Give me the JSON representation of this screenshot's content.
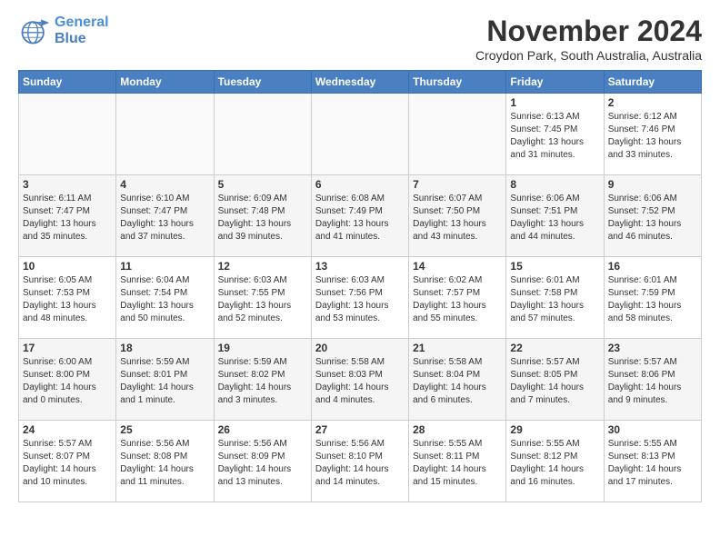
{
  "header": {
    "logo_line1": "General",
    "logo_line2": "Blue",
    "month": "November 2024",
    "location": "Croydon Park, South Australia, Australia"
  },
  "days_of_week": [
    "Sunday",
    "Monday",
    "Tuesday",
    "Wednesday",
    "Thursday",
    "Friday",
    "Saturday"
  ],
  "weeks": [
    [
      {
        "day": "",
        "info": ""
      },
      {
        "day": "",
        "info": ""
      },
      {
        "day": "",
        "info": ""
      },
      {
        "day": "",
        "info": ""
      },
      {
        "day": "",
        "info": ""
      },
      {
        "day": "1",
        "info": "Sunrise: 6:13 AM\nSunset: 7:45 PM\nDaylight: 13 hours\nand 31 minutes."
      },
      {
        "day": "2",
        "info": "Sunrise: 6:12 AM\nSunset: 7:46 PM\nDaylight: 13 hours\nand 33 minutes."
      }
    ],
    [
      {
        "day": "3",
        "info": "Sunrise: 6:11 AM\nSunset: 7:47 PM\nDaylight: 13 hours\nand 35 minutes."
      },
      {
        "day": "4",
        "info": "Sunrise: 6:10 AM\nSunset: 7:47 PM\nDaylight: 13 hours\nand 37 minutes."
      },
      {
        "day": "5",
        "info": "Sunrise: 6:09 AM\nSunset: 7:48 PM\nDaylight: 13 hours\nand 39 minutes."
      },
      {
        "day": "6",
        "info": "Sunrise: 6:08 AM\nSunset: 7:49 PM\nDaylight: 13 hours\nand 41 minutes."
      },
      {
        "day": "7",
        "info": "Sunrise: 6:07 AM\nSunset: 7:50 PM\nDaylight: 13 hours\nand 43 minutes."
      },
      {
        "day": "8",
        "info": "Sunrise: 6:06 AM\nSunset: 7:51 PM\nDaylight: 13 hours\nand 44 minutes."
      },
      {
        "day": "9",
        "info": "Sunrise: 6:06 AM\nSunset: 7:52 PM\nDaylight: 13 hours\nand 46 minutes."
      }
    ],
    [
      {
        "day": "10",
        "info": "Sunrise: 6:05 AM\nSunset: 7:53 PM\nDaylight: 13 hours\nand 48 minutes."
      },
      {
        "day": "11",
        "info": "Sunrise: 6:04 AM\nSunset: 7:54 PM\nDaylight: 13 hours\nand 50 minutes."
      },
      {
        "day": "12",
        "info": "Sunrise: 6:03 AM\nSunset: 7:55 PM\nDaylight: 13 hours\nand 52 minutes."
      },
      {
        "day": "13",
        "info": "Sunrise: 6:03 AM\nSunset: 7:56 PM\nDaylight: 13 hours\nand 53 minutes."
      },
      {
        "day": "14",
        "info": "Sunrise: 6:02 AM\nSunset: 7:57 PM\nDaylight: 13 hours\nand 55 minutes."
      },
      {
        "day": "15",
        "info": "Sunrise: 6:01 AM\nSunset: 7:58 PM\nDaylight: 13 hours\nand 57 minutes."
      },
      {
        "day": "16",
        "info": "Sunrise: 6:01 AM\nSunset: 7:59 PM\nDaylight: 13 hours\nand 58 minutes."
      }
    ],
    [
      {
        "day": "17",
        "info": "Sunrise: 6:00 AM\nSunset: 8:00 PM\nDaylight: 14 hours\nand 0 minutes."
      },
      {
        "day": "18",
        "info": "Sunrise: 5:59 AM\nSunset: 8:01 PM\nDaylight: 14 hours\nand 1 minute."
      },
      {
        "day": "19",
        "info": "Sunrise: 5:59 AM\nSunset: 8:02 PM\nDaylight: 14 hours\nand 3 minutes."
      },
      {
        "day": "20",
        "info": "Sunrise: 5:58 AM\nSunset: 8:03 PM\nDaylight: 14 hours\nand 4 minutes."
      },
      {
        "day": "21",
        "info": "Sunrise: 5:58 AM\nSunset: 8:04 PM\nDaylight: 14 hours\nand 6 minutes."
      },
      {
        "day": "22",
        "info": "Sunrise: 5:57 AM\nSunset: 8:05 PM\nDaylight: 14 hours\nand 7 minutes."
      },
      {
        "day": "23",
        "info": "Sunrise: 5:57 AM\nSunset: 8:06 PM\nDaylight: 14 hours\nand 9 minutes."
      }
    ],
    [
      {
        "day": "24",
        "info": "Sunrise: 5:57 AM\nSunset: 8:07 PM\nDaylight: 14 hours\nand 10 minutes."
      },
      {
        "day": "25",
        "info": "Sunrise: 5:56 AM\nSunset: 8:08 PM\nDaylight: 14 hours\nand 11 minutes."
      },
      {
        "day": "26",
        "info": "Sunrise: 5:56 AM\nSunset: 8:09 PM\nDaylight: 14 hours\nand 13 minutes."
      },
      {
        "day": "27",
        "info": "Sunrise: 5:56 AM\nSunset: 8:10 PM\nDaylight: 14 hours\nand 14 minutes."
      },
      {
        "day": "28",
        "info": "Sunrise: 5:55 AM\nSunset: 8:11 PM\nDaylight: 14 hours\nand 15 minutes."
      },
      {
        "day": "29",
        "info": "Sunrise: 5:55 AM\nSunset: 8:12 PM\nDaylight: 14 hours\nand 16 minutes."
      },
      {
        "day": "30",
        "info": "Sunrise: 5:55 AM\nSunset: 8:13 PM\nDaylight: 14 hours\nand 17 minutes."
      }
    ]
  ]
}
